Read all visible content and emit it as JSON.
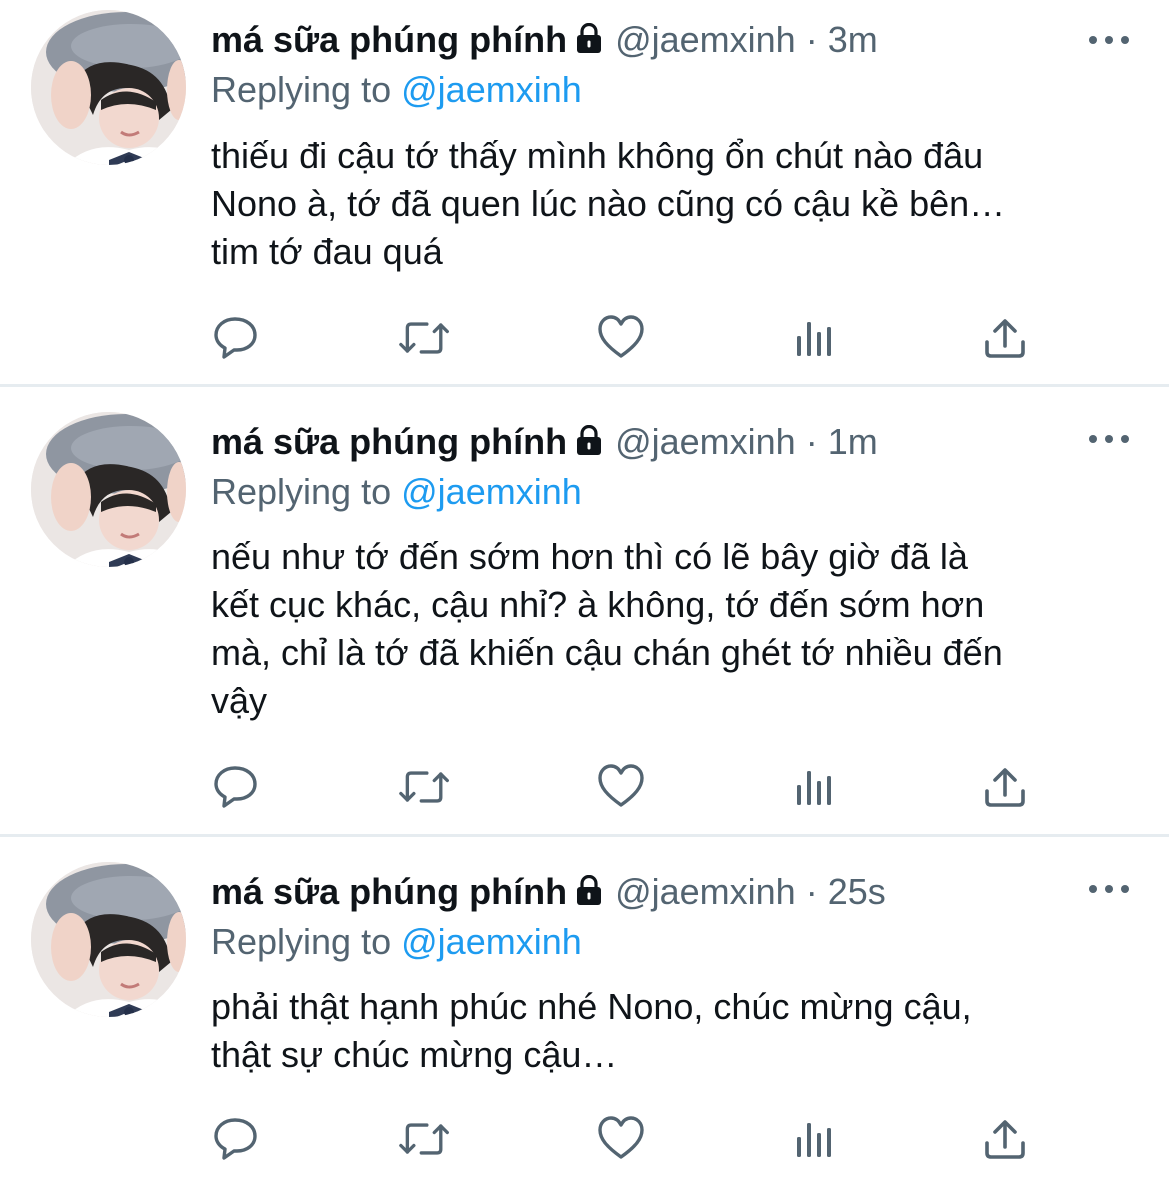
{
  "tweets": [
    {
      "author_name": "má sữa phúng phính",
      "handle": "@jaemxinh",
      "separator": "·",
      "time": "3m",
      "replying_prefix": "Replying to",
      "replying_to": "@jaemxinh",
      "text": "thiếu đi cậu tớ thấy mình không ổn chút nào đâu\nNono à, tớ đã quen lúc nào cũng có cậu kề bên…\ntim tớ đau quá"
    },
    {
      "author_name": "má sữa phúng phính",
      "handle": "@jaemxinh",
      "separator": "·",
      "time": "1m",
      "replying_prefix": "Replying to",
      "replying_to": "@jaemxinh",
      "text": "nếu như tớ đến sớm hơn thì có lẽ bây giờ đã là\nkết cục khác, cậu nhỉ? à không, tớ đến sớm hơn\nmà, chỉ là tớ đã khiến cậu chán ghét tớ nhiều đến\nvậy"
    },
    {
      "author_name": "má sữa phúng phính",
      "handle": "@jaemxinh",
      "separator": "·",
      "time": "25s",
      "replying_prefix": "Replying to",
      "replying_to": "@jaemxinh",
      "text": "phải thật hạnh phúc nhé Nono, chúc mừng cậu,\nthật sự chúc mừng cậu…"
    }
  ],
  "icons": {
    "reply": "reply-icon",
    "retweet": "retweet-icon",
    "like": "like-icon",
    "analytics": "analytics-icon",
    "share": "share-icon",
    "lock": "lock-icon",
    "more": "more-icon"
  },
  "colors": {
    "text": "#0f1419",
    "secondary": "#536471",
    "link": "#1d9bf0",
    "divider": "#e6ecf0"
  }
}
